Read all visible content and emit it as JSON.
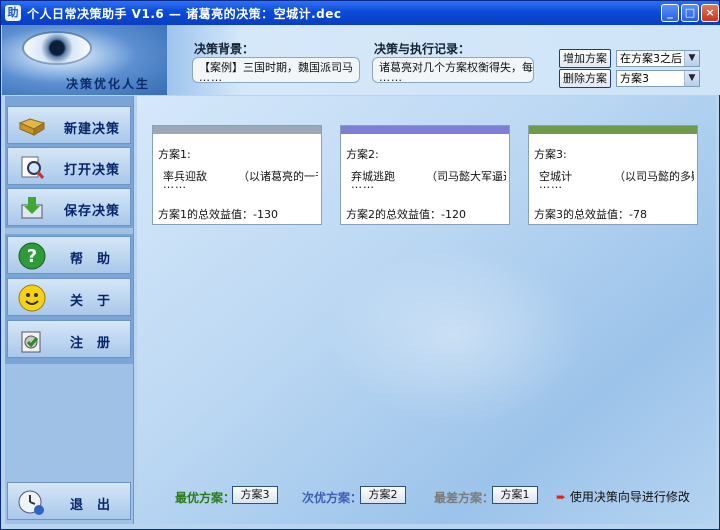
{
  "window": {
    "title": "个人日常决策助手 V1.6 — 诸葛亮的决策：空城计.dec",
    "icon_glyph": "助",
    "minimize": "_",
    "maximize": "□",
    "close": "×"
  },
  "header": {
    "slogan": "决策优化人生",
    "background_label": "决策背景：",
    "background_text": "【案例】三国时期，魏国派司马",
    "background_more": "……",
    "record_label": "决策与执行记录：",
    "record_text": "诸葛亮对几个方案权衡得失，每",
    "record_more": "……",
    "add_button": "增加方案",
    "delete_button": "删除方案",
    "position_select": "在方案3之后",
    "plan_select": "方案3"
  },
  "sidebar": {
    "items": [
      {
        "label": "新建决策",
        "icon": "folder-icon"
      },
      {
        "label": "打开决策",
        "icon": "search-icon"
      },
      {
        "label": "保存决策",
        "icon": "save-icon"
      },
      {
        "label": "帮助",
        "icon": "help-icon"
      },
      {
        "label": "关于",
        "icon": "smiley-icon"
      },
      {
        "label": "注册",
        "icon": "register-icon"
      },
      {
        "label": "退出",
        "icon": "exit-icon"
      }
    ]
  },
  "plans": [
    {
      "title": "方案1:",
      "name": "率兵迎敌",
      "desc": "（以诸葛亮的一千",
      "more": "……",
      "score": "方案1的总效益值：-130",
      "color": "#9aa9b8"
    },
    {
      "title": "方案2:",
      "name": "弃城逃跑",
      "desc": "（司马懿大军逼近",
      "more": "……",
      "score": "方案2的总效益值：-120",
      "color": "#7d7fd6"
    },
    {
      "title": "方案3:",
      "name": "空城计",
      "desc": "（以司马懿的多疑性",
      "more": "……",
      "score": "方案3的总效益值：-78",
      "color": "#6f9a4a"
    }
  ],
  "bottom": {
    "best_label": "最优方案：",
    "best_value": "方案3",
    "second_label": "次优方案：",
    "second_value": "方案2",
    "worst_label": "最差方案：",
    "worst_value": "方案1",
    "wizard_text": "使用决策向导进行修改"
  },
  "colors": {
    "best": "#2a7a1a",
    "second": "#3e5eb0",
    "worst": "#7a7a7a"
  }
}
